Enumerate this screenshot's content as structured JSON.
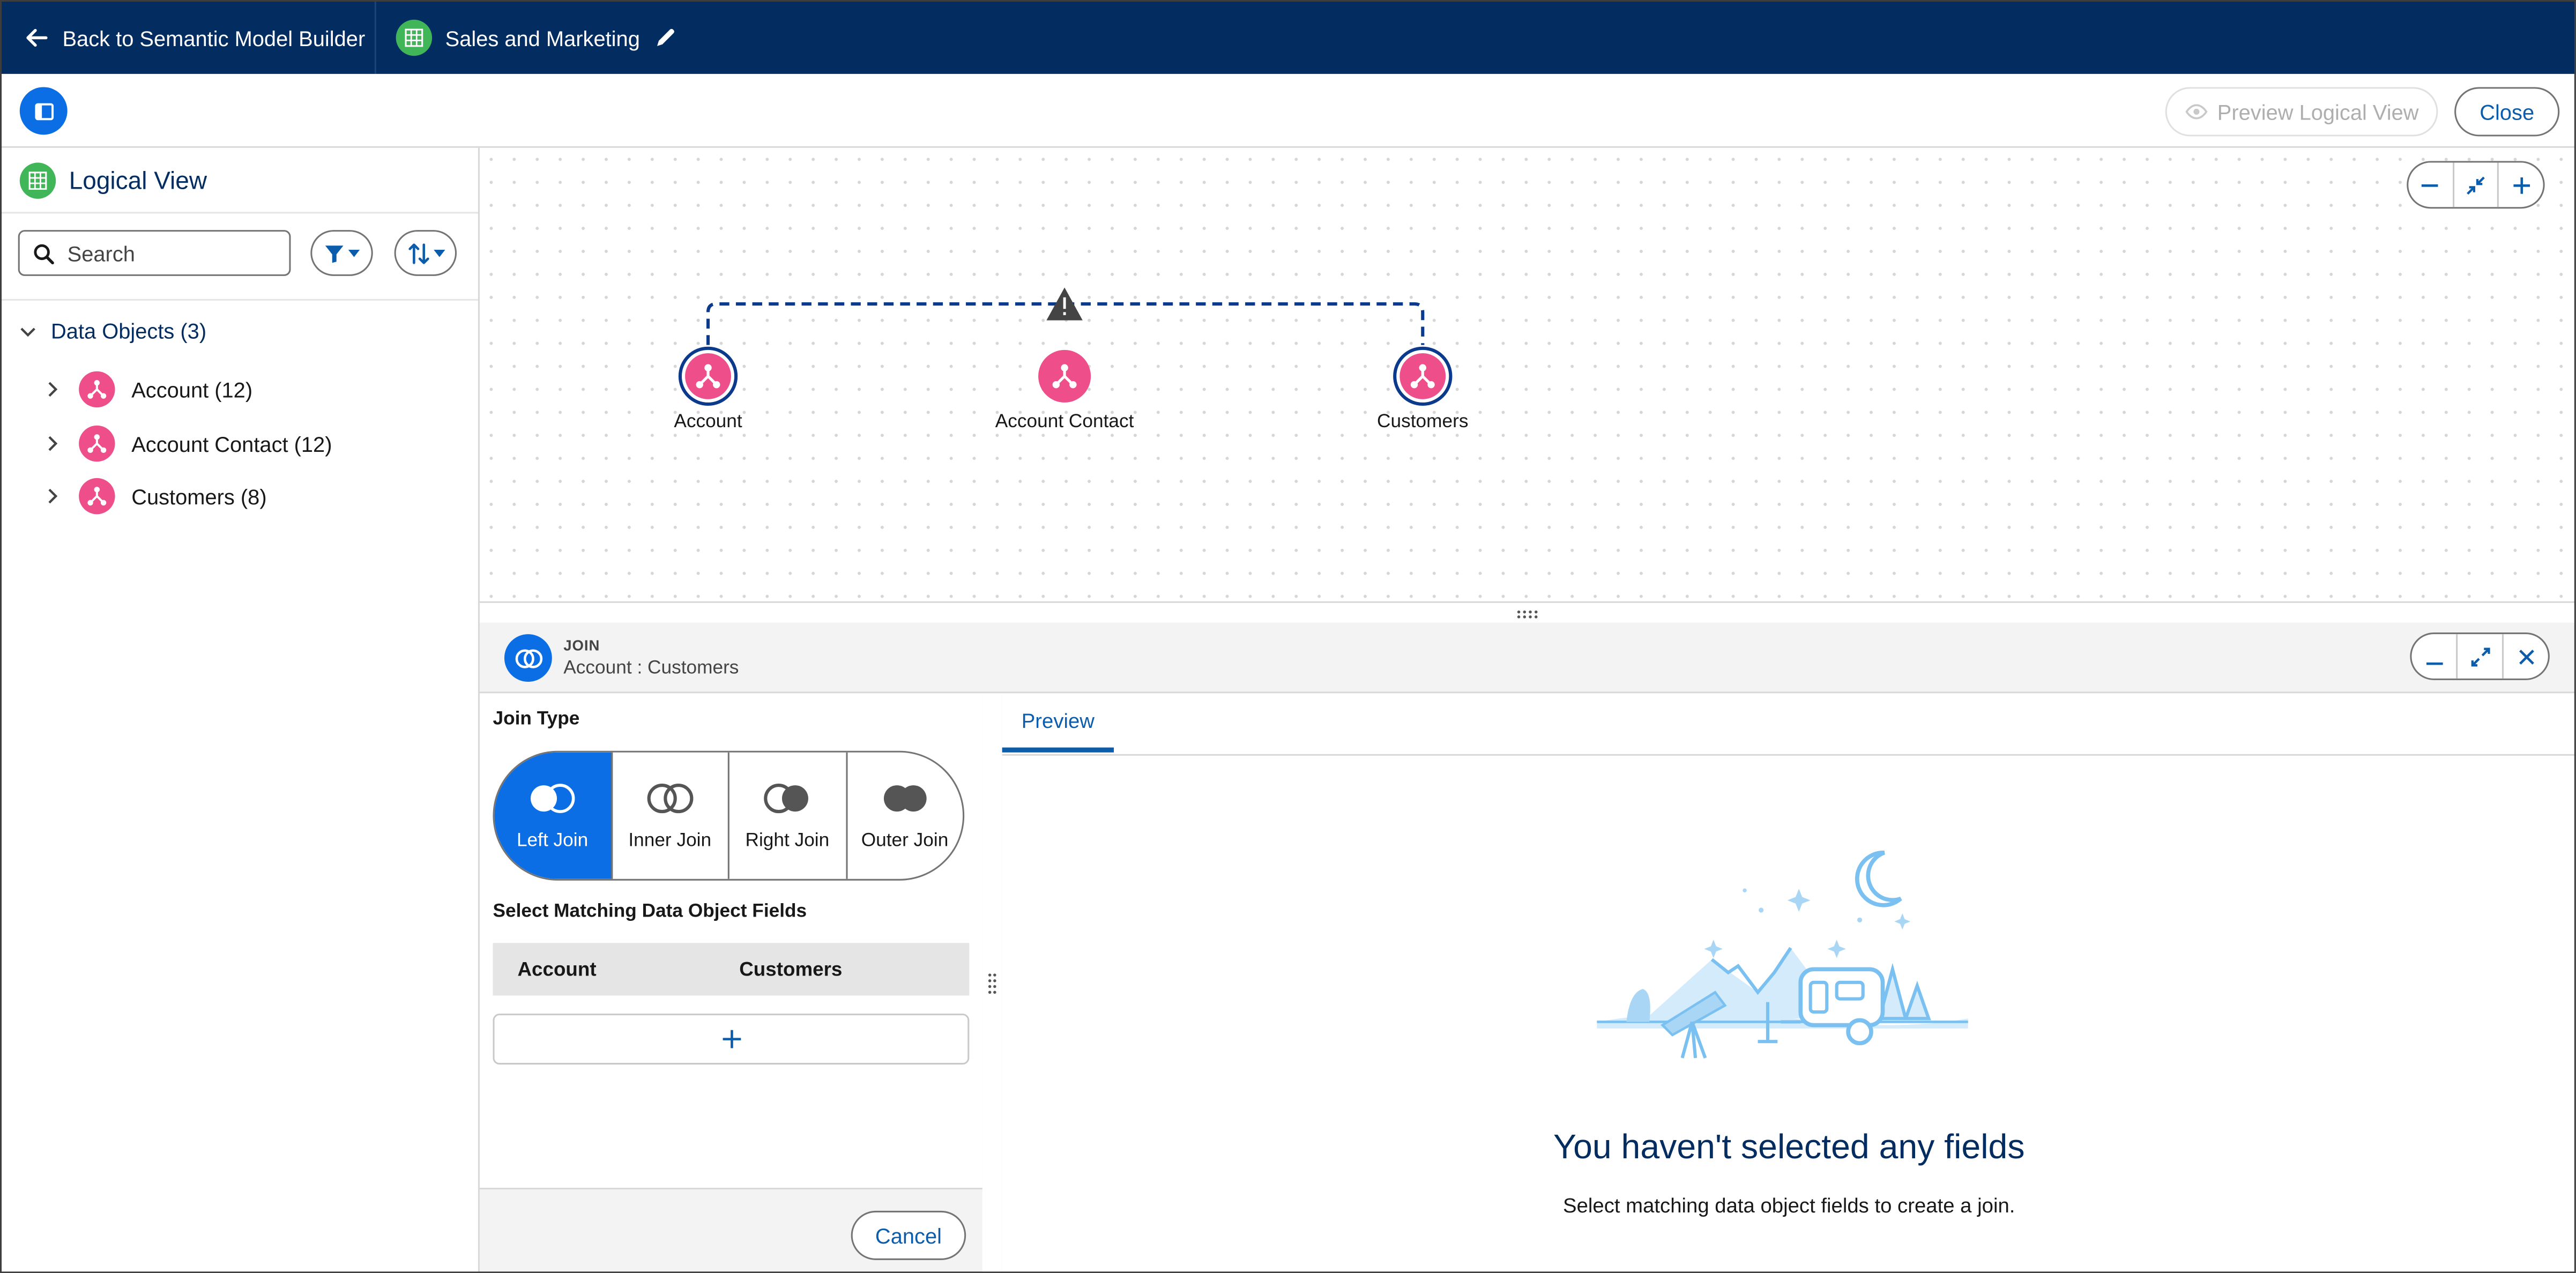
{
  "topbar": {
    "back_label": "Back to Semantic Model Builder",
    "model_title": "Sales and Marketing"
  },
  "toolbar": {
    "preview_label": "Preview Logical View",
    "close_label": "Close"
  },
  "sidebar": {
    "title": "Logical View",
    "search_placeholder": "Search",
    "tree_root": "Data Objects (3)",
    "items": [
      {
        "label": "Account (12)"
      },
      {
        "label": "Account Contact (12)"
      },
      {
        "label": "Customers (8)"
      }
    ]
  },
  "canvas": {
    "nodes": [
      {
        "label": "Account",
        "selected": true
      },
      {
        "label": "Account Contact",
        "selected": false
      },
      {
        "label": "Customers",
        "selected": true
      }
    ],
    "link_warning": "warning-icon"
  },
  "join": {
    "type_label": "JOIN",
    "subtitle": "Account : Customers",
    "join_type_heading": "Join Type",
    "options": [
      {
        "label": "Left Join",
        "active": true
      },
      {
        "label": "Inner Join",
        "active": false
      },
      {
        "label": "Right Join",
        "active": false
      },
      {
        "label": "Outer Join",
        "active": false
      }
    ],
    "fields_heading": "Select Matching Data Object Fields",
    "columns": [
      "Account",
      "Customers"
    ],
    "cancel_label": "Cancel"
  },
  "preview": {
    "tab_label": "Preview",
    "empty_title": "You haven't selected any fields",
    "empty_message": "Select matching data object fields to create a join."
  },
  "colors": {
    "brand_navy": "#032d60",
    "accent_blue": "#0b6ee5",
    "object_pink": "#ee4f8a",
    "sheet_green": "#41b658"
  }
}
